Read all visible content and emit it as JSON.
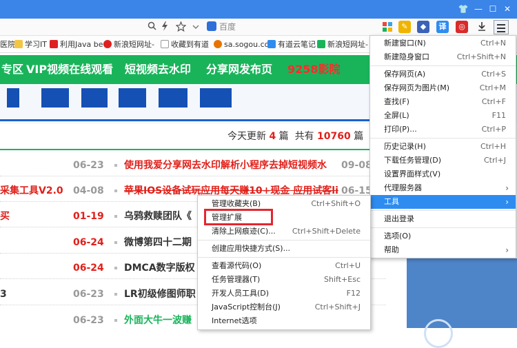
{
  "titlebar": {
    "buttons": [
      "👕",
      "—",
      "☐",
      "✕"
    ]
  },
  "toolbar": {
    "zoom_icon": "zoom-icon",
    "lightning_icon": "lightning-icon",
    "star_icon": "star-icon",
    "dropdown_icon": "chevron-down-icon",
    "search_placeholder": "百度",
    "download_icon": "download-icon",
    "extensions": [
      {
        "name": "apps-grid-icon",
        "color": "#3aa3e3",
        "glyph": "▦"
      },
      {
        "name": "weather-icon",
        "color": "#f0b400",
        "glyph": "✎"
      },
      {
        "name": "cube-icon",
        "color": "#3a63b8",
        "glyph": "◆"
      },
      {
        "name": "translate-icon",
        "color": "#2e8cf0",
        "glyph": "译"
      },
      {
        "name": "capture-icon",
        "color": "#d92b2b",
        "glyph": "◎"
      }
    ]
  },
  "bookmarks": [
    {
      "label": "医院",
      "icon": "bookmark-icon",
      "color": "#f4c542"
    },
    {
      "label": "学习IT",
      "icon": "folder-icon",
      "color": "#f4c542"
    },
    {
      "label": "利用Java be",
      "icon": "c-icon",
      "color": "#e02020"
    },
    {
      "label": "新浪短网址-",
      "icon": "weibo-icon",
      "color": "#e02020"
    },
    {
      "label": "收藏到有道",
      "icon": "page-icon",
      "color": "#999999"
    },
    {
      "label": "sa.sogou.co",
      "icon": "sogou-icon",
      "color": "#e87400"
    },
    {
      "label": "有道云笔记",
      "icon": "youdao-icon",
      "color": "#2e8cf0"
    },
    {
      "label": "新浪短网址-",
      "icon": "puzzle-icon",
      "color": "#19b45a"
    }
  ],
  "nav": {
    "items": [
      "专区",
      "VIP视频在线观看",
      "短视频去水印",
      "分享网发布页"
    ],
    "highlight": "9258影院"
  },
  "stats": {
    "today_prefix": "今天更新",
    "today_count": "4",
    "today_unit": "篇",
    "total_prefix": "共有",
    "total_count": "10760",
    "total_unit": "篇"
  },
  "list": [
    {
      "left": "",
      "date": "06-23",
      "date_hl": false,
      "title": "使用我爱分享网去水印解析小程序去掉短视频水",
      "title_style": "red",
      "date2": "09-08"
    },
    {
      "left": "采集工具V2.0",
      "date": "04-08",
      "date_hl": false,
      "title": "苹果IOS设备试玩应用每天赚10+现金 应用试客li",
      "title_style": "red overlay",
      "date2": "06-15"
    },
    {
      "left": "买",
      "date": "01-19",
      "date_hl": true,
      "title": "乌鸦救赎团队《",
      "title_style": "",
      "date2": ""
    },
    {
      "left": "",
      "date": "06-24",
      "date_hl": true,
      "title": "微博第四十二期",
      "title_style": "",
      "date2": ""
    },
    {
      "left": "",
      "date": "06-24",
      "date_hl": true,
      "title": "DMCA数字版权",
      "title_style": "",
      "date2": ""
    },
    {
      "left": "3",
      "date": "06-23",
      "date_hl": false,
      "title": "LR初级修图师职",
      "title_style": "",
      "date2": ""
    },
    {
      "left": "",
      "date": "06-23",
      "date_hl": false,
      "title": "外面大牛一波赚",
      "title_style": "green",
      "date2": ""
    }
  ],
  "main_menu": [
    {
      "label": "新建窗口(N)",
      "shortcut": "Ctrl+N"
    },
    {
      "label": "新建隐身窗口",
      "shortcut": "Ctrl+Shift+N"
    },
    {
      "sep": true
    },
    {
      "label": "保存网页(A)",
      "shortcut": "Ctrl+S"
    },
    {
      "label": "保存网页为图片(M)",
      "shortcut": "Ctrl+M"
    },
    {
      "label": "查找(F)",
      "shortcut": "Ctrl+F"
    },
    {
      "label": "全屏(L)",
      "shortcut": "F11"
    },
    {
      "label": "打印(P)...",
      "shortcut": "Ctrl+P"
    },
    {
      "sep": true
    },
    {
      "label": "历史记录(H)",
      "shortcut": "Ctrl+H"
    },
    {
      "label": "下载任务管理(D)",
      "shortcut": "Ctrl+J"
    },
    {
      "label": "设置界面样式(V)",
      "shortcut": ""
    },
    {
      "label": "代理服务器",
      "shortcut": "",
      "submenu": true
    },
    {
      "label": "工具",
      "shortcut": "",
      "submenu": true,
      "active": true
    },
    {
      "sep": true
    },
    {
      "label": "退出登录",
      "shortcut": ""
    },
    {
      "sep": true
    },
    {
      "label": "选项(O)",
      "shortcut": ""
    },
    {
      "label": "帮助",
      "shortcut": "",
      "submenu": true
    }
  ],
  "tools_menu": [
    {
      "label": "管理收藏夹(B)",
      "shortcut": "Ctrl+Shift+O"
    },
    {
      "label": "管理扩展",
      "shortcut": "",
      "highlighted": true
    },
    {
      "label": "清除上网痕迹(C)...",
      "shortcut": "Ctrl+Shift+Delete"
    },
    {
      "sep": true
    },
    {
      "label": "创建应用快捷方式(S)...",
      "shortcut": ""
    },
    {
      "sep": true
    },
    {
      "label": "查看源代码(O)",
      "shortcut": "Ctrl+U"
    },
    {
      "label": "任务管理器(T)",
      "shortcut": "Shift+Esc"
    },
    {
      "label": "开发人员工具(D)",
      "shortcut": "F12"
    },
    {
      "label": "JavaScript控制台(J)",
      "shortcut": "Ctrl+Shift+J"
    },
    {
      "label": "Internet选项",
      "shortcut": ""
    }
  ]
}
